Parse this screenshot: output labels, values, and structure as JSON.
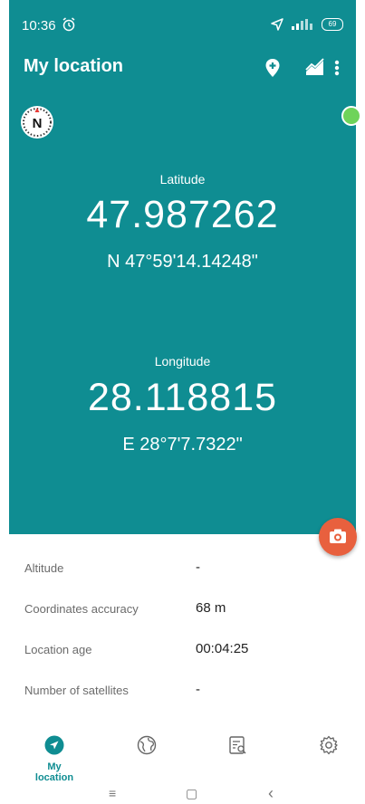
{
  "status_bar": {
    "time": "10:36",
    "battery": "69"
  },
  "app_bar": {
    "title": "My location"
  },
  "colors": {
    "primary": "#0f8d92",
    "accent": "#e8603e",
    "status_dot": "#6fd35a"
  },
  "latitude": {
    "label": "Latitude",
    "decimal": "47.987262",
    "dms": "N 47°59'14.14248\""
  },
  "longitude": {
    "label": "Longitude",
    "decimal": "28.118815",
    "dms": "E 28°7'7.7322\""
  },
  "info": [
    {
      "label": "Altitude",
      "value": "-"
    },
    {
      "label": "Coordinates accuracy",
      "value": "68 m"
    },
    {
      "label": "Location age",
      "value": "00:04:25"
    },
    {
      "label": "Number of satellites",
      "value": "-"
    }
  ],
  "bottom_nav": {
    "items": [
      {
        "label": "My location",
        "icon": "navigation-icon"
      },
      {
        "label": "",
        "icon": "globe-icon"
      },
      {
        "label": "",
        "icon": "list-search-icon"
      },
      {
        "label": "",
        "icon": "settings-gear-icon"
      }
    ]
  },
  "system_nav": {
    "menu": "≡",
    "home": "▢",
    "back": "‹"
  }
}
